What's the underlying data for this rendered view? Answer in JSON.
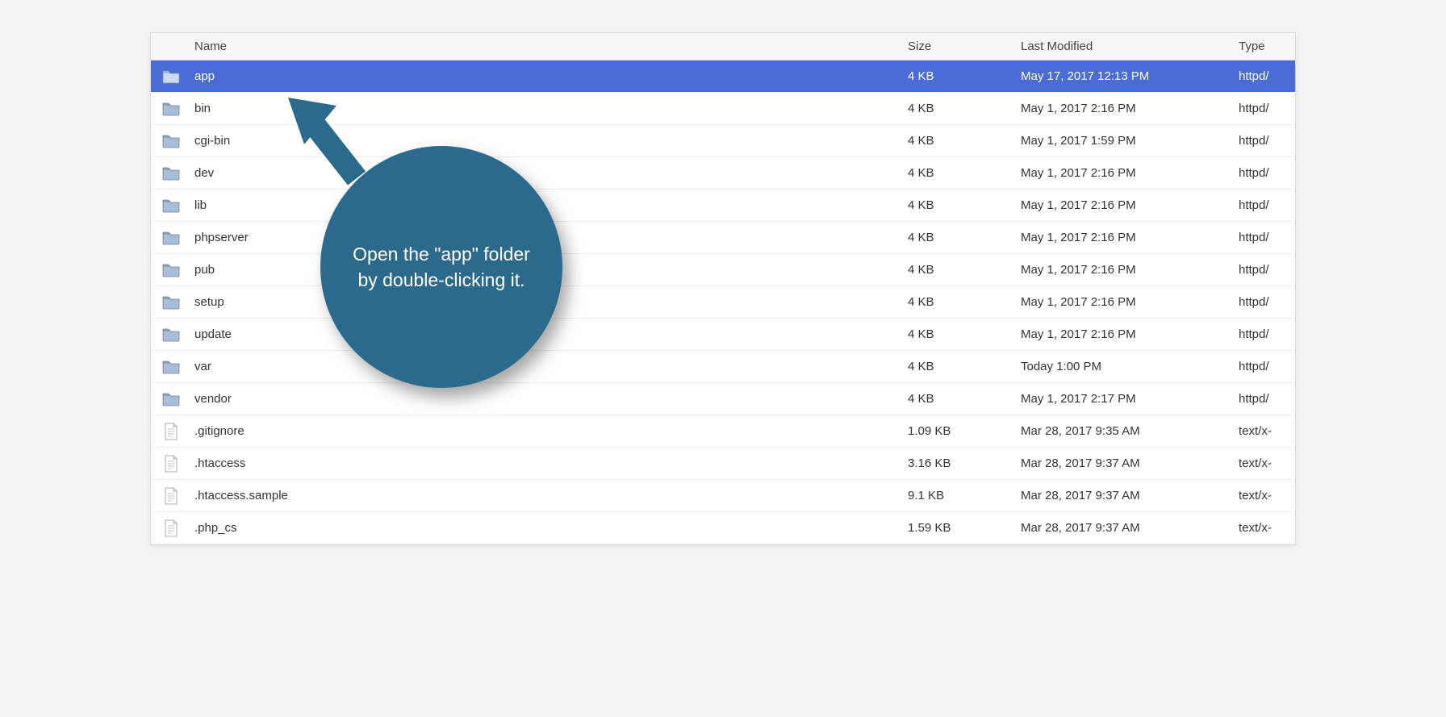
{
  "columns": {
    "name": "Name",
    "size": "Size",
    "modified": "Last Modified",
    "type": "Type"
  },
  "callout": {
    "text": "Open the \"app\" folder by double-clicking it."
  },
  "files": [
    {
      "icon": "folder",
      "name": "app",
      "size": "4 KB",
      "modified": "May 17, 2017 12:13 PM",
      "type": "httpd/",
      "selected": true
    },
    {
      "icon": "folder",
      "name": "bin",
      "size": "4 KB",
      "modified": "May 1, 2017 2:16 PM",
      "type": "httpd/",
      "selected": false
    },
    {
      "icon": "folder",
      "name": "cgi-bin",
      "size": "4 KB",
      "modified": "May 1, 2017 1:59 PM",
      "type": "httpd/",
      "selected": false
    },
    {
      "icon": "folder",
      "name": "dev",
      "size": "4 KB",
      "modified": "May 1, 2017 2:16 PM",
      "type": "httpd/",
      "selected": false
    },
    {
      "icon": "folder",
      "name": "lib",
      "size": "4 KB",
      "modified": "May 1, 2017 2:16 PM",
      "type": "httpd/",
      "selected": false
    },
    {
      "icon": "folder",
      "name": "phpserver",
      "size": "4 KB",
      "modified": "May 1, 2017 2:16 PM",
      "type": "httpd/",
      "selected": false
    },
    {
      "icon": "folder",
      "name": "pub",
      "size": "4 KB",
      "modified": "May 1, 2017 2:16 PM",
      "type": "httpd/",
      "selected": false
    },
    {
      "icon": "folder",
      "name": "setup",
      "size": "4 KB",
      "modified": "May 1, 2017 2:16 PM",
      "type": "httpd/",
      "selected": false
    },
    {
      "icon": "folder",
      "name": "update",
      "size": "4 KB",
      "modified": "May 1, 2017 2:16 PM",
      "type": "httpd/",
      "selected": false
    },
    {
      "icon": "folder",
      "name": "var",
      "size": "4 KB",
      "modified": "Today 1:00 PM",
      "type": "httpd/",
      "selected": false
    },
    {
      "icon": "folder",
      "name": "vendor",
      "size": "4 KB",
      "modified": "May 1, 2017 2:17 PM",
      "type": "httpd/",
      "selected": false
    },
    {
      "icon": "file",
      "name": ".gitignore",
      "size": "1.09 KB",
      "modified": "Mar 28, 2017 9:35 AM",
      "type": "text/x-",
      "selected": false
    },
    {
      "icon": "file",
      "name": ".htaccess",
      "size": "3.16 KB",
      "modified": "Mar 28, 2017 9:37 AM",
      "type": "text/x-",
      "selected": false
    },
    {
      "icon": "file",
      "name": ".htaccess.sample",
      "size": "9.1 KB",
      "modified": "Mar 28, 2017 9:37 AM",
      "type": "text/x-",
      "selected": false
    },
    {
      "icon": "file",
      "name": ".php_cs",
      "size": "1.59 KB",
      "modified": "Mar 28, 2017 9:37 AM",
      "type": "text/x-",
      "selected": false
    }
  ]
}
